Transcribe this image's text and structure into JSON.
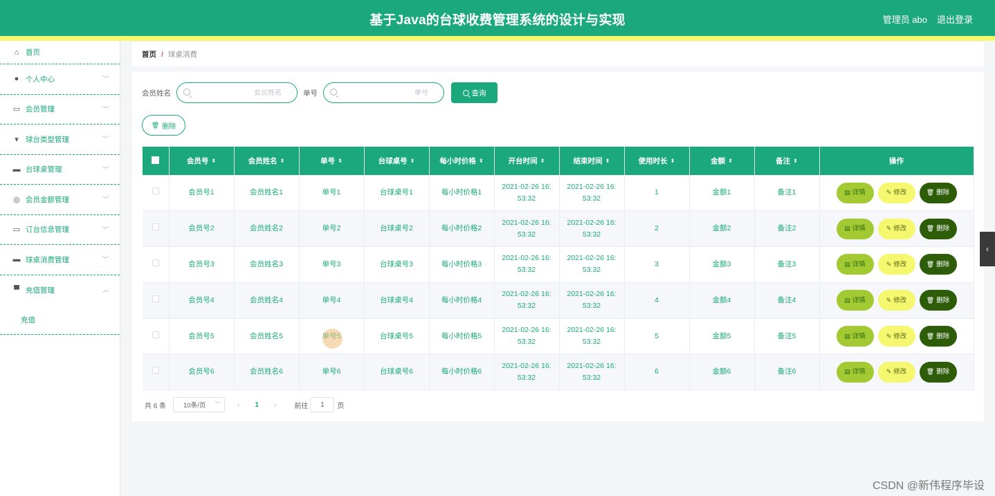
{
  "header": {
    "title": "基于Java的台球收费管理系统的设计与实现",
    "user": "管理员 abo",
    "logout": "退出登录"
  },
  "sidebar": {
    "items": [
      {
        "label": "首页",
        "icon": "home-icon"
      },
      {
        "label": "个人中心",
        "icon": "user-icon"
      },
      {
        "label": "会员管理",
        "icon": "chat-icon"
      },
      {
        "label": "球台类型管理",
        "icon": "flag-icon"
      },
      {
        "label": "台球桌管理",
        "icon": "monitor-icon"
      },
      {
        "label": "会员金额管理",
        "icon": "compass-icon"
      },
      {
        "label": "订台信息管理",
        "icon": "card-icon"
      },
      {
        "label": "球桌消费管理",
        "icon": "message-icon"
      },
      {
        "label": "充值管理",
        "icon": "briefcase-icon"
      }
    ],
    "sub_item": "充值"
  },
  "breadcrumb": {
    "home": "首页",
    "sep": "/",
    "current": "球桌消费"
  },
  "search": {
    "name_label": "会员姓名",
    "name_placeholder": "会员姓名",
    "order_label": "单号",
    "order_placeholder": "单号",
    "query_button": "查询"
  },
  "actions": {
    "batch_delete": "删除"
  },
  "table": {
    "columns": [
      "会员号",
      "会员姓名",
      "单号",
      "台球桌号",
      "每小时价格",
      "开台时间",
      "结束时间",
      "使用时长",
      "金额",
      "备注",
      "操作"
    ],
    "rows": [
      {
        "member_no": "会员号1",
        "member_name": "会员姓名1",
        "order_no": "单号1",
        "table_no": "台球桌号1",
        "price": "每小时价格1",
        "start_a": "2021-02-26 16:",
        "start_b": "53:32",
        "end_a": "2021-02-26 16:",
        "end_b": "53:32",
        "duration": "1",
        "amount": "金额1",
        "note": "备注1"
      },
      {
        "member_no": "会员号2",
        "member_name": "会员姓名2",
        "order_no": "单号2",
        "table_no": "台球桌号2",
        "price": "每小时价格2",
        "start_a": "2021-02-26 16:",
        "start_b": "53:32",
        "end_a": "2021-02-26 16:",
        "end_b": "53:32",
        "duration": "2",
        "amount": "金额2",
        "note": "备注2"
      },
      {
        "member_no": "会员号3",
        "member_name": "会员姓名3",
        "order_no": "单号3",
        "table_no": "台球桌号3",
        "price": "每小时价格3",
        "start_a": "2021-02-26 16:",
        "start_b": "53:32",
        "end_a": "2021-02-26 16:",
        "end_b": "53:32",
        "duration": "3",
        "amount": "金额3",
        "note": "备注3"
      },
      {
        "member_no": "会员号4",
        "member_name": "会员姓名4",
        "order_no": "单号4",
        "table_no": "台球桌号4",
        "price": "每小时价格4",
        "start_a": "2021-02-26 16:",
        "start_b": "53:32",
        "end_a": "2021-02-26 16:",
        "end_b": "53:32",
        "duration": "4",
        "amount": "金额4",
        "note": "备注4"
      },
      {
        "member_no": "会员号5",
        "member_name": "会员姓名5",
        "order_no": "单号5",
        "table_no": "台球桌号5",
        "price": "每小时价格5",
        "start_a": "2021-02-26 16:",
        "start_b": "53:32",
        "end_a": "2021-02-26 16:",
        "end_b": "53:32",
        "duration": "5",
        "amount": "金额5",
        "note": "备注5"
      },
      {
        "member_no": "会员号6",
        "member_name": "会员姓名6",
        "order_no": "单号6",
        "table_no": "台球桌号6",
        "price": "每小时价格6",
        "start_a": "2021-02-26 16:",
        "start_b": "53:32",
        "end_a": "2021-02-26 16:",
        "end_b": "53:32",
        "duration": "6",
        "amount": "金额6",
        "note": "备注6"
      }
    ],
    "op_detail": "详情",
    "op_edit": "修改",
    "op_delete": "删除"
  },
  "pagination": {
    "total": "共 6 条",
    "page_size": "10条/页",
    "current_page": "1",
    "goto_label": "前往",
    "goto_value": "1",
    "unit": "页"
  },
  "watermark": "CSDN @新伟程序毕设",
  "colors": {
    "primary": "#1ba97c",
    "stripe": "#f5f76e",
    "detail_btn": "#a3c933",
    "edit_btn": "#f5f76e",
    "delete_btn": "#2e5d0a"
  }
}
